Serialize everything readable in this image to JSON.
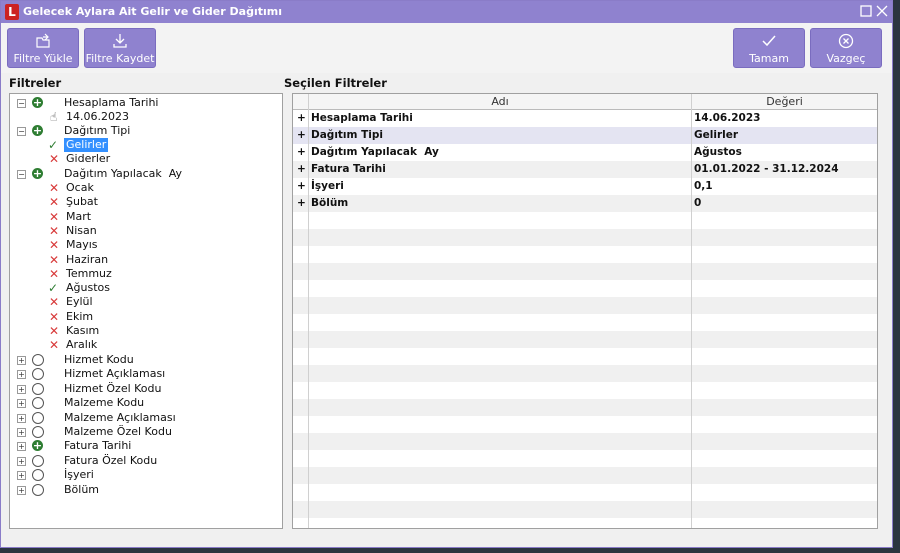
{
  "window": {
    "title": "Gelecek Aylara Ait Gelir ve Gider Dağıtımı",
    "logo": "L"
  },
  "toolbar": {
    "filtre_yukle": "Filtre Yükle",
    "filtre_kaydet": "Filtre Kaydet",
    "tamam": "Tamam",
    "vazgec": "Vazgeç"
  },
  "labels": {
    "filtreler": "Filtreler",
    "secilen": "Seçilen Filtreler"
  },
  "tree": {
    "hesaplama": "Hesaplama Tarihi",
    "hesaplama_val": "14.06.2023",
    "dagitim_tipi": "Dağıtım Tipi",
    "gelirler": "Gelirler",
    "giderler": "Giderler",
    "dagitim_ay": "Dağıtım Yapılacak  Ay",
    "months": [
      "Ocak",
      "Şubat",
      "Mart",
      "Nisan",
      "Mayıs",
      "Haziran",
      "Temmuz",
      "Ağustos",
      "Eylül",
      "Ekim",
      "Kasım",
      "Aralık"
    ],
    "others": [
      "Hizmet Kodu",
      "Hizmet Açıklaması",
      "Hizmet Özel Kodu",
      "Malzeme Kodu",
      "Malzeme Açıklaması",
      "Malzeme Özel Kodu",
      "Fatura Tarihi",
      "Fatura Özel Kodu",
      "İşyeri",
      "Bölüm"
    ]
  },
  "grid": {
    "col_name": "Adı",
    "col_value": "Değeri",
    "rows": [
      {
        "name": "Hesaplama Tarihi",
        "value": "14.06.2023"
      },
      {
        "name": "Dağıtım Tipi",
        "value": "Gelirler"
      },
      {
        "name": "Dağıtım Yapılacak  Ay",
        "value": "Ağustos"
      },
      {
        "name": "Fatura Tarihi",
        "value": "01.01.2022 - 31.12.2024"
      },
      {
        "name": "İşyeri",
        "value": "0,1"
      },
      {
        "name": "Bölüm",
        "value": "0"
      }
    ]
  },
  "colors": {
    "accent": "#8f82cf",
    "check": "#2e7d32",
    "cross": "#d83a3a",
    "selection": "#3390ff"
  }
}
